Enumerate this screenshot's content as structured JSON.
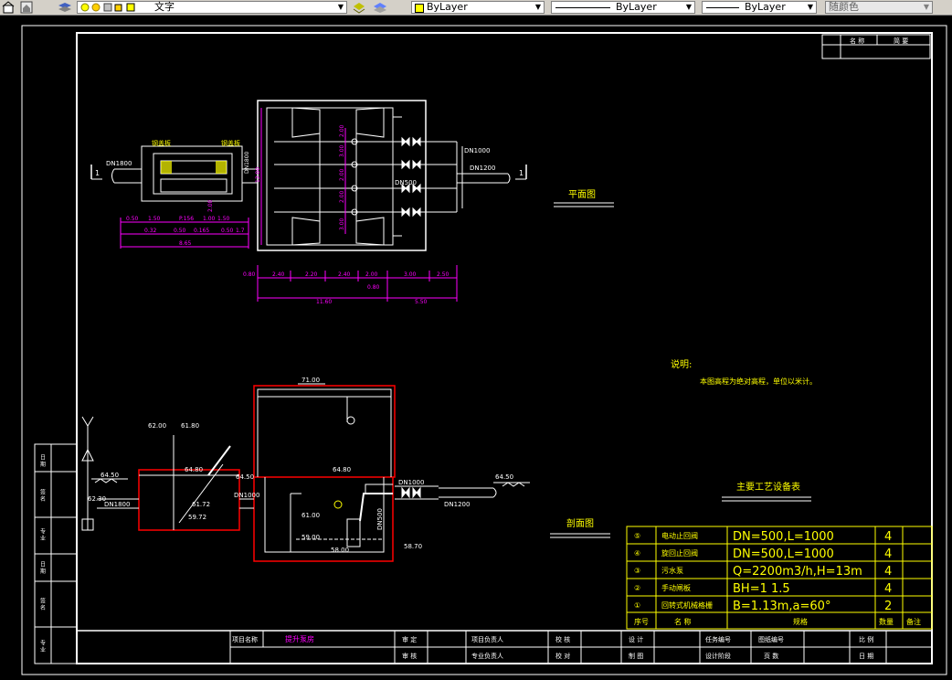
{
  "toolbar": {
    "layer_name": "文字",
    "color_value": "ByLayer",
    "linetype_value": "ByLayer",
    "lineweight_value": "ByLayer",
    "plotstyle_value": "随颜色",
    "icons": [
      "layer-manager-icon",
      "bulb-icon",
      "sun-icon",
      "layer-freeze-icon",
      "lock-icon",
      "color-swatch-icon",
      "layer-previous-icon",
      "match-layer-icon"
    ]
  },
  "colors": {
    "background": "#000000",
    "frame": "#ffffff",
    "dim": "#ff00ff",
    "label": "#ffff00",
    "wall": "#ff0000",
    "pipe": "#ffffff"
  },
  "drawing": {
    "plan_title": "平面图",
    "section_title": "剖面图",
    "notes_title": "说明:",
    "notes_text": "本图高程为绝对高程，单位以米计。",
    "equipment_title": "主要工艺设备表",
    "plan_labels": {
      "steel_plate_left": "钢盖板",
      "steel_plate_right": "钢盖板",
      "dn1800": "DN1800",
      "dn1800_v": "DN1800",
      "dn1000": "DN1000",
      "dn1200": "DN1200",
      "dn500": "DN500",
      "section_mark": "1",
      "dim_small": [
        "0.50",
        "1.50",
        "P.156",
        "1.00",
        "1.50",
        "0.32",
        "0.50",
        "0.165",
        "0.50",
        "1.7"
      ],
      "dim_total_small": "8.65",
      "dim_bottom": [
        "0.80",
        "2.40",
        "2.20",
        "2.40",
        "2.00",
        "3.00",
        "2.50"
      ],
      "dim_080": "0.80",
      "dim_1160": "11.60",
      "dim_550": "5.50",
      "dim_vertical": [
        "2.00",
        "3.00",
        "2.00",
        "2.00",
        "3.00",
        "12.00",
        "2.00"
      ]
    },
    "section_labels": {
      "roof": "71.00",
      "e6200": "62.00",
      "e6180": "61.80",
      "e6450_left": "64.50",
      "e6230": "62.30",
      "e6480": "64.80",
      "e6450_mid": "64.50",
      "e6172": "61.72",
      "e5972": "59.72",
      "e6480_b": "64.80",
      "e6100": "61.00",
      "e5900": "59.00",
      "e5800": "58.00",
      "e5870": "58.70",
      "e6450_right": "64.50",
      "dn1800": "DN1800",
      "dn1000": "DN1000",
      "dn1000_s": "DN1000",
      "dn1200": "DN1200",
      "dn500": "DN500"
    }
  },
  "equipment_table": {
    "rows": [
      {
        "no": "⑤",
        "name": "电动止回阀",
        "spec": "DN=500,L=1000",
        "qty": "4",
        "note": ""
      },
      {
        "no": "④",
        "name": "旋回止回阀",
        "spec": "DN=500,L=1000",
        "qty": "4",
        "note": ""
      },
      {
        "no": "③",
        "name": "污水泵",
        "spec": "Q=2200m3/h,H=13m",
        "qty": "4",
        "note": ""
      },
      {
        "no": "②",
        "name": "手动闸板",
        "spec": "BH=1 1.5",
        "qty": "4",
        "note": ""
      },
      {
        "no": "①",
        "name": "回转式机械格栅",
        "spec": "B=1.13m,a=60°",
        "qty": "2",
        "note": ""
      }
    ],
    "header": {
      "no": "序号",
      "name": "名 称",
      "spec": "规格",
      "qty": "数量",
      "note": "备注"
    }
  },
  "revision_table": {
    "c1": "名 称",
    "c2": "简 要"
  },
  "left_strip": [
    "日 期",
    "签 名",
    "专 业",
    "日 期",
    "签 名",
    "专 业"
  ],
  "title_block": {
    "project_label": "项目名称",
    "project_name": "提升泵房",
    "review": "审 定",
    "audit": "审 核",
    "proj_leader": "项目负责人",
    "spec_leader": "专业负责人",
    "check": "校 核",
    "proof": "校 对",
    "design": "设 计",
    "draw": "制 图",
    "task_no": "任务编号",
    "design_stage": "设计阶段",
    "drawing_no": "图纸编号",
    "page_no": "页 数",
    "scale": "比 例",
    "date": "日 期"
  }
}
